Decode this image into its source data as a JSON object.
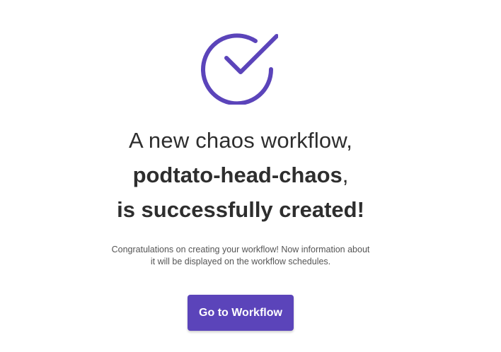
{
  "colors": {
    "accent": "#5b44ba",
    "text": "#2e2e2e",
    "muted_text": "#555555",
    "background": "#ffffff"
  },
  "icons": {
    "success": "check-circle-icon"
  },
  "heading": {
    "line1": "A new chaos workflow,",
    "workflow_name": "podtato-head-chaos",
    "comma": ",",
    "line3": "is successfully created!"
  },
  "message": {
    "line1": "Congratulations on creating your workflow! Now information about",
    "line2": "it will be displayed on the workflow schedules."
  },
  "button": {
    "label": "Go to Workflow"
  }
}
